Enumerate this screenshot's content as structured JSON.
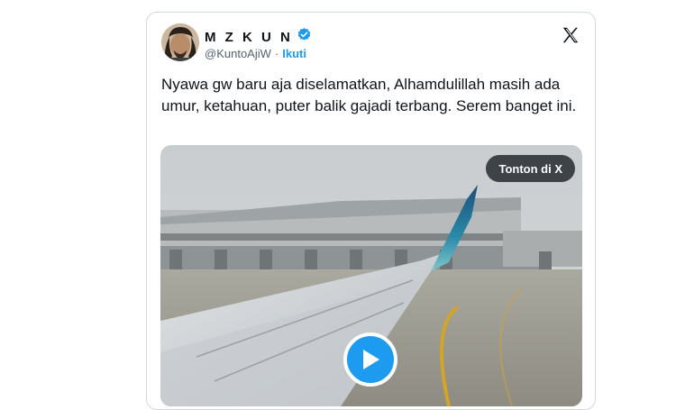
{
  "tweet": {
    "display_name": "M Z K U N",
    "handle": "@KuntoAjiW",
    "separator": "·",
    "follow_label": "Ikuti",
    "text": "Nyawa gw baru aja diselamatkan, Alhamdulillah masih ada umur, ketahuan, puter balik gajadi terbang. Serem banget ini.",
    "verified_icon": "verified-badge-icon",
    "platform_icon": "x-logo-icon"
  },
  "media": {
    "watch_label": "Tonton di X",
    "play_icon": "play-icon"
  },
  "colors": {
    "accent": "#1d9bf0",
    "text": "#0f1419",
    "secondary": "#536471"
  }
}
